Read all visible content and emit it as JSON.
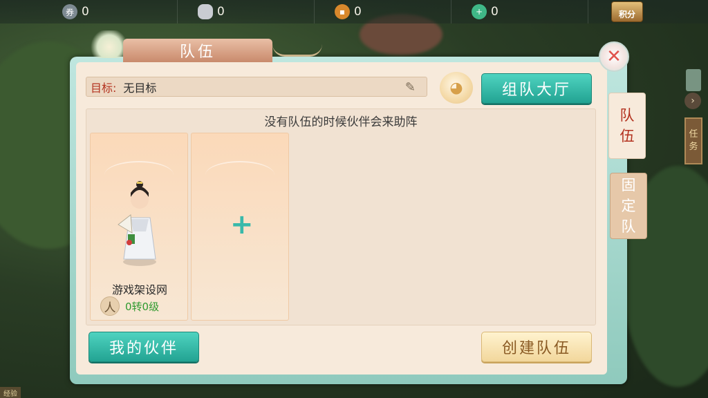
{
  "currencies": [
    {
      "icon": "coupon-icon",
      "value": "0"
    },
    {
      "icon": "silver-ingot-icon",
      "value": "0"
    },
    {
      "icon": "copper-coin-icon",
      "value": "0"
    },
    {
      "icon": "jade-plus-icon",
      "value": "0"
    }
  ],
  "score_badge": "积分",
  "title": "队伍",
  "goal": {
    "label": "目标:",
    "value": "无目标"
  },
  "buttons": {
    "team_hall": "组队大厅",
    "my_partners": "我的伙伴",
    "create_team": "创建队伍"
  },
  "hint": "没有队伍的时候伙伴会来助阵",
  "partner_card": {
    "name": "游戏架设网",
    "race": "人",
    "level": "0转0级"
  },
  "side_tabs": {
    "team": [
      "队",
      "伍"
    ],
    "fixed_team": [
      "固",
      "定",
      "队"
    ]
  },
  "side_mission": [
    "任",
    "务"
  ],
  "bottom_label": "经验",
  "colors": {
    "accent_teal": "#22a392",
    "goal_red": "#b3321f",
    "level_green": "#2f9a2f"
  }
}
